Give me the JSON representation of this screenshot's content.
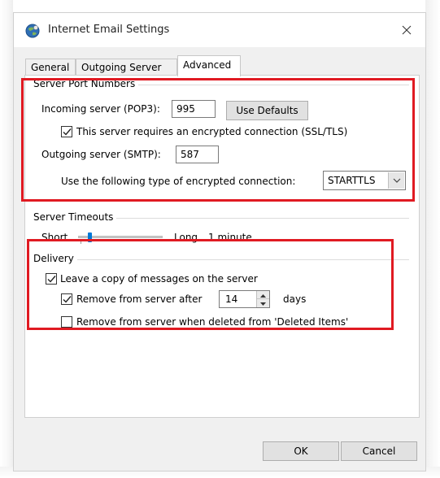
{
  "window": {
    "title": "Internet Email Settings",
    "close_glyph": "✕"
  },
  "tabs": [
    {
      "label": "General",
      "active": false
    },
    {
      "label": "Outgoing Server",
      "active": false
    },
    {
      "label": "Advanced",
      "active": true
    }
  ],
  "server_ports": {
    "group_label": "Server Port Numbers",
    "incoming_label": "Incoming server (POP3):",
    "incoming_value": "995",
    "use_defaults_label": "Use Defaults",
    "ssl_checkbox_label": "This server requires an encrypted connection (SSL/TLS)",
    "ssl_checked": true,
    "outgoing_label": "Outgoing server (SMTP):",
    "outgoing_value": "587",
    "encryption_label": "Use the following type of encrypted connection:",
    "encryption_value": "STARTTLS"
  },
  "timeouts": {
    "group_label": "Server Timeouts",
    "short_label": "Short",
    "long_label": "Long",
    "value_label": "1 minute"
  },
  "delivery": {
    "group_label": "Delivery",
    "leave_copy_label": "Leave a copy of messages on the server",
    "leave_copy_checked": true,
    "remove_after_label": "Remove from server after",
    "remove_after_checked": true,
    "remove_after_days": "14",
    "days_label": "days",
    "remove_deleted_label": "Remove from server when deleted from 'Deleted Items'",
    "remove_deleted_checked": false
  },
  "footer": {
    "ok_label": "OK",
    "cancel_label": "Cancel"
  },
  "colors": {
    "highlight_border": "#e01a22",
    "slider_thumb": "#0078d7"
  },
  "icons": {
    "app": "outlook-globe-icon",
    "close": "close-icon",
    "check": "checkmark-icon",
    "dropdown": "chevron-down-icon"
  }
}
